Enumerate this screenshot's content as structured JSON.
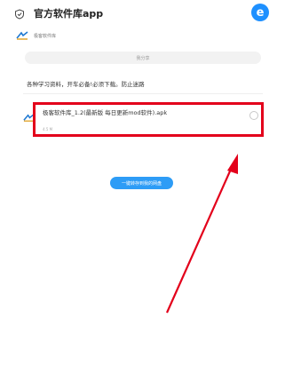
{
  "header": {
    "title": "官方软件库app",
    "browser_icon": "e"
  },
  "brand": {
    "name": "极客软件库"
  },
  "share": {
    "label": "我分享"
  },
  "description": "各种学习资料，开车必备!必须下载。防止迷路",
  "file": {
    "name": "极客软件库_1.2(最新版 每日更新mod软件).apk",
    "size": "4.5 M"
  },
  "actions": {
    "save_label": "一键转存到我的网盘"
  },
  "colors": {
    "accent": "#2d9cf6",
    "highlight": "#e3001b"
  }
}
